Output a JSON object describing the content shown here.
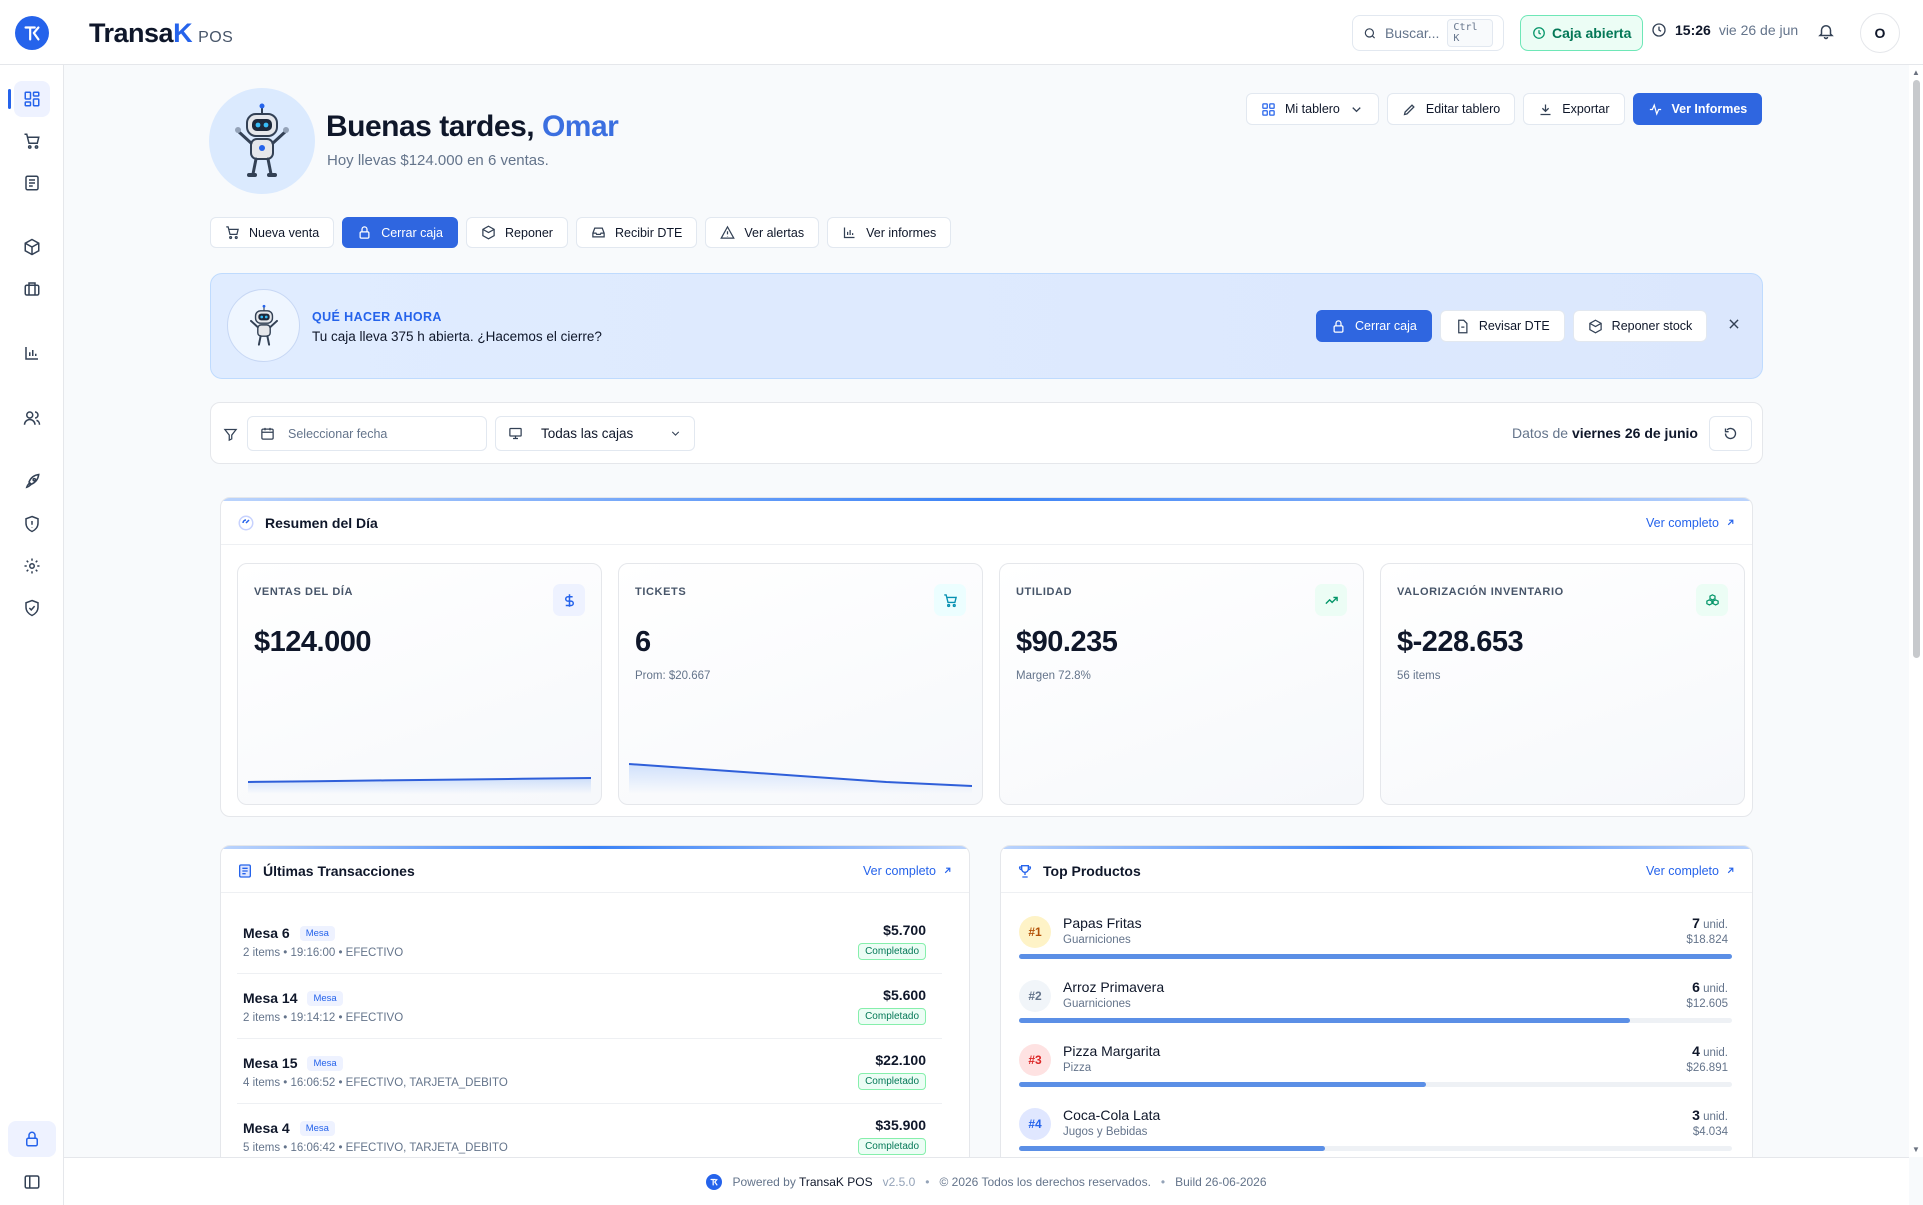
{
  "app": {
    "brand_main": "Transa",
    "brand_k": "K",
    "brand_suffix": "POS"
  },
  "topbar": {
    "search_placeholder": "Buscar...",
    "search_shortcut": "Ctrl K",
    "caja_status": "Caja abierta",
    "time": "15:26",
    "date": "vie 26 de jun",
    "user_initial": "O"
  },
  "sidebar": {
    "items": [
      {
        "icon": "dashboard-icon",
        "active": true
      },
      {
        "icon": "cart-icon"
      },
      {
        "icon": "document-icon"
      },
      {
        "icon": "box-icon"
      },
      {
        "icon": "briefcase-icon"
      },
      {
        "icon": "bar-chart-icon"
      },
      {
        "icon": "users-icon"
      },
      {
        "icon": "rocket-icon"
      },
      {
        "icon": "shield-alert-icon"
      },
      {
        "icon": "gear-icon"
      },
      {
        "icon": "shield-check-icon"
      }
    ],
    "bottom": [
      {
        "icon": "lock-icon"
      },
      {
        "icon": "sidebar-toggle-icon"
      }
    ]
  },
  "header": {
    "greeting": "Buenas tardes,",
    "user_name": "Omar",
    "subtitle": "Hoy llevas $124.000 en 6 ventas.",
    "dashboard_select": "Mi tablero",
    "edit_dashboard": "Editar tablero",
    "export": "Exportar",
    "view_reports": "Ver Informes"
  },
  "quick_actions": {
    "new_sale": "Nueva venta",
    "close_register": "Cerrar caja",
    "restock": "Reponer",
    "receive_dte": "Recibir DTE",
    "view_alerts": "Ver alertas",
    "view_reports": "Ver informes"
  },
  "alert": {
    "title": "QUÉ HACER AHORA",
    "message": "Tu caja lleva 375 h abierta. ¿Hacemos el cierre?",
    "close_register": "Cerrar caja",
    "review_dte": "Revisar DTE",
    "restock": "Reponer stock"
  },
  "filters": {
    "date_placeholder": "Seleccionar fecha",
    "register_select": "Todas las cajas",
    "data_of_label": "Datos de",
    "data_of_date": "viernes 26 de junio"
  },
  "summary": {
    "title": "Resumen del Día",
    "view_full": "Ver completo",
    "kpis": [
      {
        "label": "VENTAS DEL DÍA",
        "value": "$124.000",
        "sub": "",
        "icon": "dollar-icon",
        "color": "#2563eb",
        "bg": "#eef2ff",
        "trend": [
          0.3,
          0.32,
          0.34,
          0.36,
          0.38,
          0.4
        ]
      },
      {
        "label": "TICKETS",
        "value": "6",
        "sub": "Prom: $20.667",
        "icon": "cart-icon",
        "color": "#0891b2",
        "bg": "#ecfeff",
        "trend": [
          0.75,
          0.6,
          0.45,
          0.3,
          0.2
        ]
      },
      {
        "label": "UTILIDAD",
        "value": "$90.235",
        "sub": "Margen 72.8%",
        "icon": "trending-up-icon",
        "color": "#059669",
        "bg": "#ecfdf5",
        "trend": []
      },
      {
        "label": "VALORIZACIÓN INVENTARIO",
        "value": "$-228.653",
        "sub": "56 items",
        "icon": "boxes-icon",
        "color": "#059669",
        "bg": "#ecfdf5",
        "trend": []
      }
    ]
  },
  "transactions": {
    "title": "Últimas Transacciones",
    "view_full": "Ver completo",
    "rows": [
      {
        "name": "Mesa 6",
        "tag": "Mesa",
        "meta": "2 items • 19:16:00 • EFECTIVO",
        "amount": "$5.700",
        "status": "Completado"
      },
      {
        "name": "Mesa 14",
        "tag": "Mesa",
        "meta": "2 items • 19:14:12 • EFECTIVO",
        "amount": "$5.600",
        "status": "Completado"
      },
      {
        "name": "Mesa 15",
        "tag": "Mesa",
        "meta": "4 items • 16:06:52 • EFECTIVO, TARJETA_DEBITO",
        "amount": "$22.100",
        "status": "Completado"
      },
      {
        "name": "Mesa 4",
        "tag": "Mesa",
        "meta": "5 items • 16:06:42 • EFECTIVO, TARJETA_DEBITO",
        "amount": "$35.900",
        "status": "Completado"
      }
    ]
  },
  "top_products": {
    "title": "Top Productos",
    "view_full": "Ver completo",
    "unit_label": "unid.",
    "rows": [
      {
        "rank": "#1",
        "name": "Papas Fritas",
        "category": "Guarniciones",
        "qty": "7",
        "total": "$18.824",
        "share": 1.0,
        "rank_bg": "#fef3c7",
        "rank_color": "#b45309"
      },
      {
        "rank": "#2",
        "name": "Arroz Primavera",
        "category": "Guarniciones",
        "qty": "6",
        "total": "$12.605",
        "share": 0.857,
        "rank_bg": "#f1f5f9",
        "rank_color": "#64748b"
      },
      {
        "rank": "#3",
        "name": "Pizza Margarita",
        "category": "Pizza",
        "qty": "4",
        "total": "$26.891",
        "share": 0.571,
        "rank_bg": "#fee2e2",
        "rank_color": "#dc2626"
      },
      {
        "rank": "#4",
        "name": "Coca-Cola Lata",
        "category": "Jugos y Bebidas",
        "qty": "3",
        "total": "$4.034",
        "share": 0.429,
        "rank_bg": "#e0e7ff",
        "rank_color": "#2563eb"
      }
    ]
  },
  "footer": {
    "powered_by": "Powered by",
    "product": "TransaK POS",
    "version": "v2.5.0",
    "copyright": "© 2026 Todos los derechos reservados.",
    "build": "Build 26-06-2026"
  }
}
